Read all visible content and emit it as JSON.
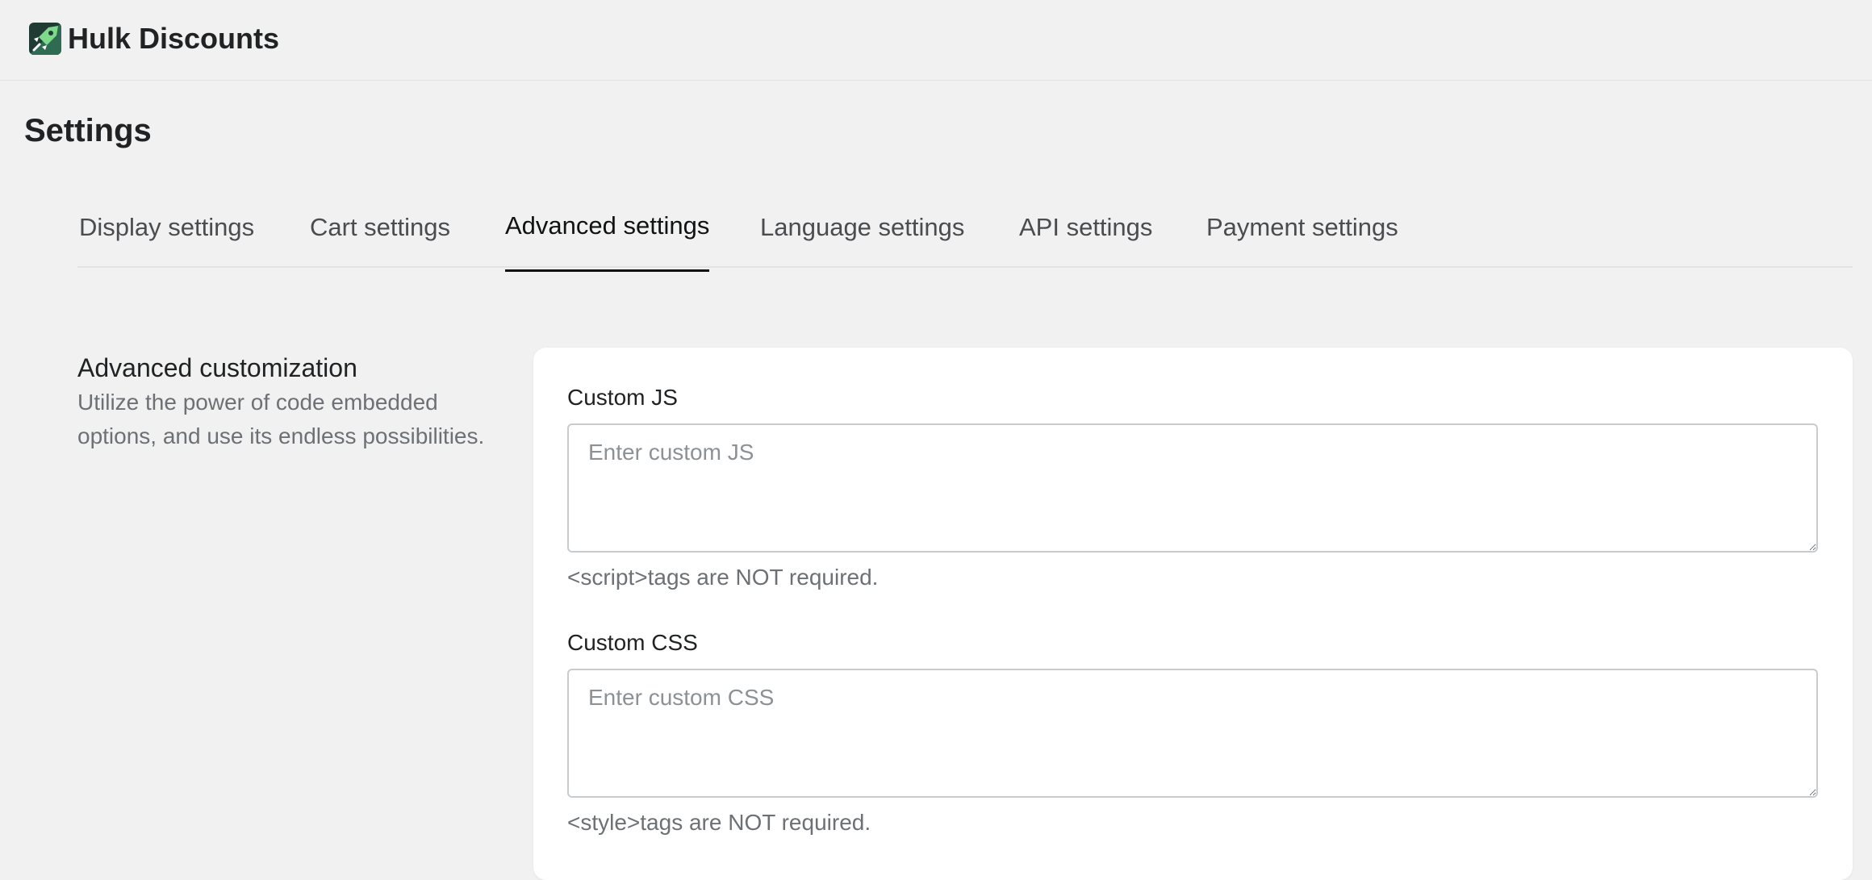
{
  "app": {
    "title": "Hulk Discounts",
    "logo_icon": "hulk-discounts-logo-icon"
  },
  "page": {
    "title": "Settings"
  },
  "tabs": [
    {
      "label": "Display settings",
      "active": false
    },
    {
      "label": "Cart settings",
      "active": false
    },
    {
      "label": "Advanced settings",
      "active": true
    },
    {
      "label": "Language settings",
      "active": false
    },
    {
      "label": "API settings",
      "active": false
    },
    {
      "label": "Payment settings",
      "active": false
    }
  ],
  "section": {
    "heading": "Advanced customization",
    "description": "Utilize the power of code embedded options, and use its endless possibilities."
  },
  "fields": {
    "custom_js": {
      "label": "Custom JS",
      "value": "",
      "placeholder": "Enter custom JS",
      "help": "<script>tags are NOT required."
    },
    "custom_css": {
      "label": "Custom CSS",
      "value": "",
      "placeholder": "Enter custom CSS",
      "help": "<style>tags are NOT required."
    }
  },
  "colors": {
    "background": "#f1f1f1",
    "card": "#ffffff",
    "logo_green": "#2e8b57",
    "active_tab": "#111213",
    "muted_text": "#6d7175"
  }
}
